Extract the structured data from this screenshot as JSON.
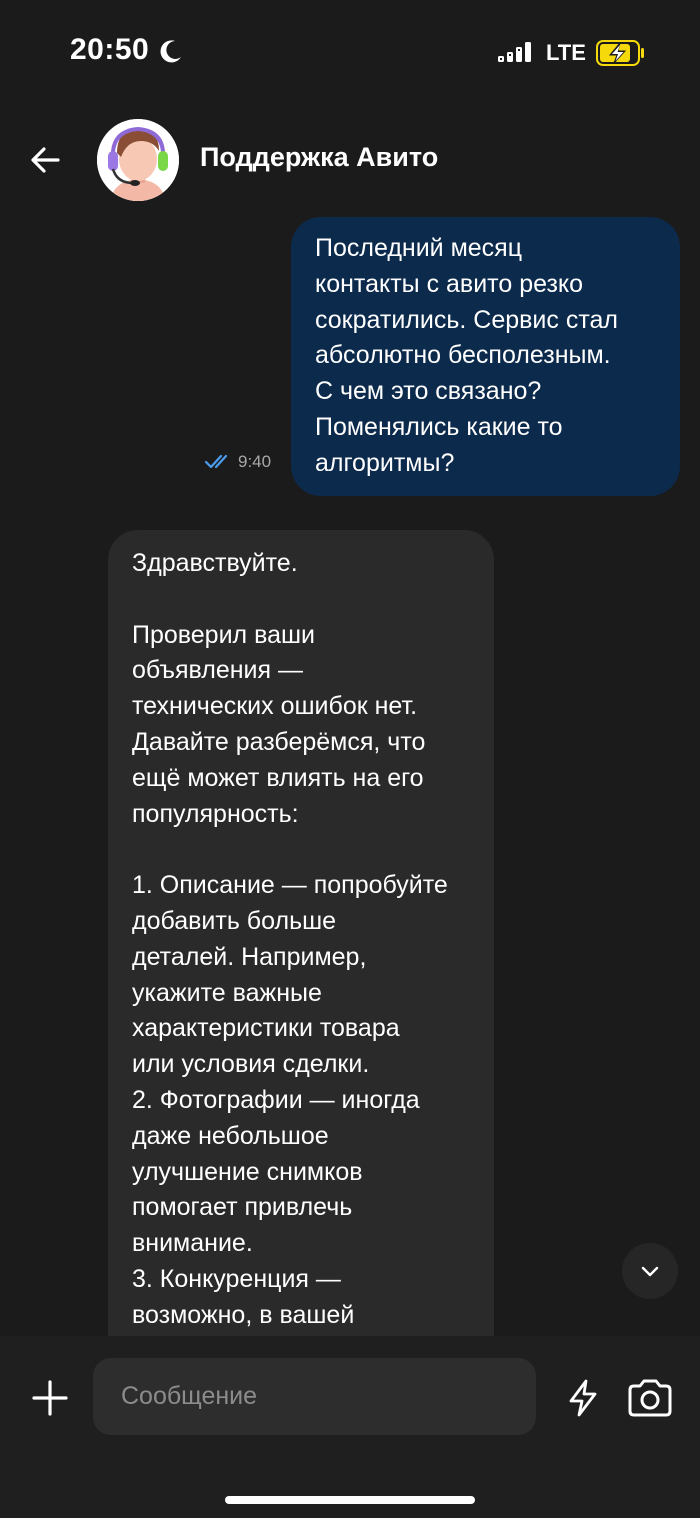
{
  "status_bar": {
    "time": "20:50",
    "network": "LTE",
    "icons": [
      "moon-icon",
      "signal-icon",
      "battery-charging-icon"
    ],
    "battery_color": "#f5d90a"
  },
  "header": {
    "title": "Поддержка Авито",
    "back_icon": "arrow-left-icon",
    "avatar": "support-agent-avatar"
  },
  "messages": [
    {
      "direction": "outgoing",
      "text": "Последний месяц\nконтакты с авито резко\nсократились. Сервис стал\nабсолютно бесполезным.\nС чем это связано?\nПоменялись какие то\nалгоритмы?",
      "time": "9:40",
      "status": "read"
    },
    {
      "direction": "incoming",
      "text": "Здравствуйте.\n\nПроверил ваши\nобъявления —\nтехнических ошибок нет.\nДавайте разберёмся, что\nещё может влиять на его\nпопулярность:\n\n1. Описание — попробуйте\nдобавить больше\nдеталей. Например,\nукажите важные\nхарактеристики товара\nили условия сделки.\n2. Фотографии — иногда\nдаже небольшое\nулучшение снимков\nпомогает привлечь\nвнимание.\n3. Конкуренция —\nвозможно, в вашей"
    }
  ],
  "composer": {
    "placeholder": "Сообщение",
    "value": ""
  },
  "colors": {
    "background": "#1b1b1b",
    "outgoing_bubble": "#0c2a4c",
    "incoming_bubble": "#2a2a2a",
    "read_ticks": "#4a9df0"
  }
}
